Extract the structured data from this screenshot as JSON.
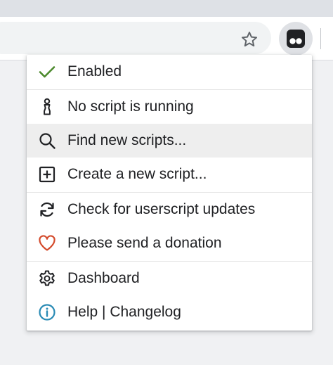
{
  "browser": {
    "bookmark_star_icon": "star-outline-icon",
    "extension_icon": "tampermonkey-icon"
  },
  "menu": {
    "items": [
      {
        "label": "Enabled",
        "icon": "checkmark-icon",
        "icon_color": "#4c8a2d"
      },
      {
        "label": "No script is running",
        "icon": "figure-icon",
        "icon_color": "#202124"
      },
      {
        "label": "Find new scripts...",
        "icon": "search-icon",
        "icon_color": "#202124",
        "state": "hover"
      },
      {
        "label": "Create a new script...",
        "icon": "plus-square-icon",
        "icon_color": "#202124"
      },
      {
        "label": "Check for userscript updates",
        "icon": "refresh-icon",
        "icon_color": "#202124"
      },
      {
        "label": "Please send a donation",
        "icon": "heart-icon",
        "icon_color": "#d44b2c"
      },
      {
        "label": "Dashboard",
        "icon": "gear-icon",
        "icon_color": "#202124"
      },
      {
        "label": "Help | Changelog",
        "icon": "info-icon",
        "icon_color": "#2a8bb5"
      }
    ]
  }
}
